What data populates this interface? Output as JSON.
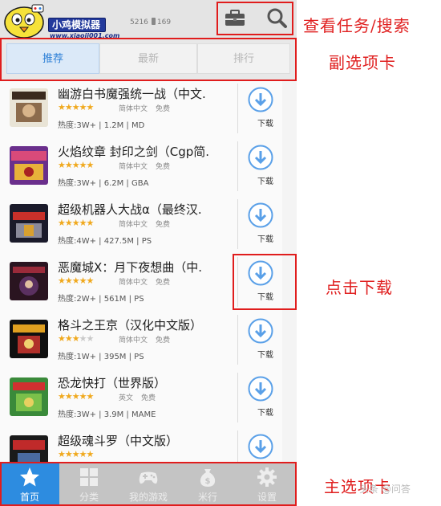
{
  "header": {
    "logo_title": "小鸡模拟器",
    "logo_url": "www.xiaoji001.com",
    "games_count": "5216",
    "device_count": "169",
    "task_icon": "toolbox-icon",
    "search_icon": "search-icon"
  },
  "subtabs": [
    {
      "label": "推荐",
      "active": true
    },
    {
      "label": "最新",
      "active": false
    },
    {
      "label": "排行",
      "active": false
    }
  ],
  "games": [
    {
      "name": "幽游白书魔强统一战（中文.",
      "stars": 5,
      "lang": "简体中文",
      "price": "免费",
      "stats": "热度:3W+ | 1.2M | MD",
      "download_label": "下载"
    },
    {
      "name": "火焰纹章 封印之剑（Cgp简.",
      "stars": 5,
      "lang": "简体中文",
      "price": "免费",
      "stats": "热度:3W+ | 6.2M | GBA",
      "download_label": "下载"
    },
    {
      "name": "超级机器人大战α（最终汉.",
      "stars": 5,
      "lang": "简体中文",
      "price": "免费",
      "stats": "热度:4W+ | 427.5M | PS",
      "download_label": "下载"
    },
    {
      "name": "恶魔城X：月下夜想曲（中.",
      "stars": 5,
      "lang": "简体中文",
      "price": "免费",
      "stats": "热度:2W+ | 561M | PS",
      "download_label": "下载"
    },
    {
      "name": "格斗之王京（汉化中文版）",
      "stars": 3,
      "lang": "简体中文",
      "price": "免费",
      "stats": "热度:1W+ | 395M | PS",
      "download_label": "下载"
    },
    {
      "name": "恐龙快打（世界版）",
      "stars": 5,
      "lang": "英文",
      "price": "免费",
      "stats": "热度:3W+ | 3.9M | MAME",
      "download_label": "下载"
    },
    {
      "name": "超级魂斗罗（中文版）",
      "stars": 5,
      "lang": "",
      "price": "",
      "stats": "",
      "download_label": "下载"
    }
  ],
  "bottom_nav": [
    {
      "label": "首页",
      "icon": "star-icon",
      "active": true
    },
    {
      "label": "分类",
      "icon": "grid-icon",
      "active": false
    },
    {
      "label": "我的游戏",
      "icon": "gamepad-icon",
      "active": false
    },
    {
      "label": "米行",
      "icon": "money-bag-icon",
      "active": false
    },
    {
      "label": "设置",
      "icon": "gear-icon",
      "active": false
    }
  ],
  "annotations": {
    "top": "查看任务/搜索",
    "subtabs": "副选项卡",
    "download": "点击下载",
    "bottom": "主选项卡"
  },
  "watermark": "头条 @问答"
}
